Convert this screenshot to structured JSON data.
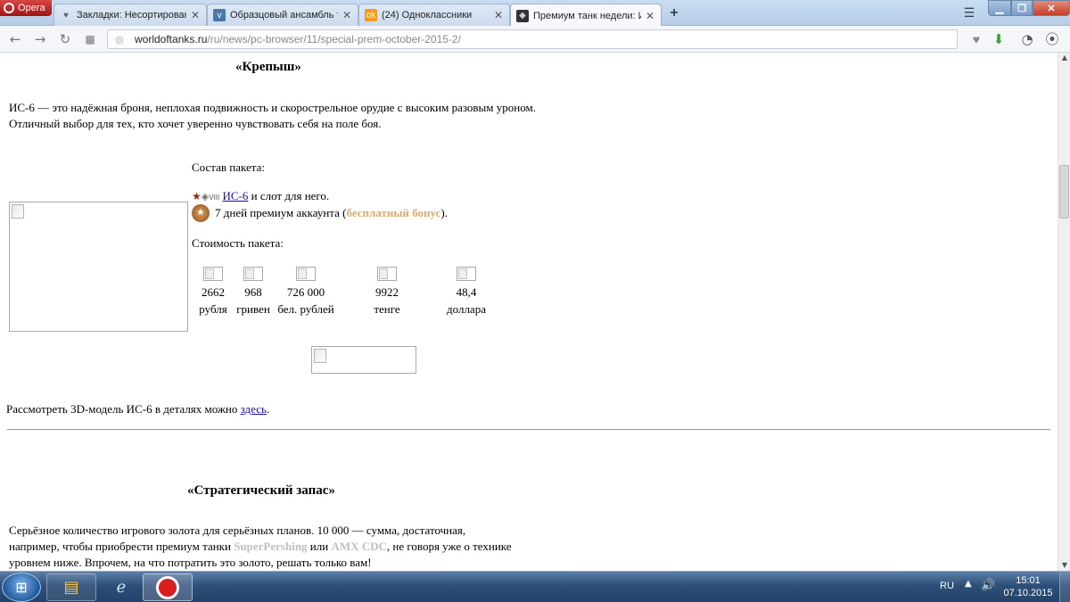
{
  "browser": {
    "menu_label": "Opera",
    "tabs": [
      {
        "label": "Закладки: Несортирован",
        "icon": "heart-icon"
      },
      {
        "label": "Образцовый ансамбль т",
        "icon": "vk-icon"
      },
      {
        "label": "(24) Одноклассники",
        "icon": "ok-icon"
      },
      {
        "label": "Премиум танк недели: И",
        "icon": "wot-icon"
      }
    ],
    "new_tab_symbol": "+",
    "address": {
      "host": "worldoftanks.ru",
      "path": "/ru/news/pc-browser/11/special-prem-october-2015-2/"
    }
  },
  "page": {
    "section1": {
      "title": "«Крепыш»",
      "description": "ИС-6 — это надёжная броня, неплохая подвижность и скорострельное орудие с высоким разовым уроном. Отличный выбор для тех, кто хочет уверенно чувствовать себя на поле боя.",
      "package_heading": "Состав пакета:",
      "tank_level": "VIII",
      "tank_link": "ИС-6",
      "tank_suffix": " и слот для него.",
      "premium_text": "7 дней премиум аккаунта (",
      "premium_bonus": "бесплатный бонус",
      "premium_close": ").",
      "price_heading": "Стоимость пакета:",
      "prices": [
        {
          "value": "2662",
          "currency": "рубля"
        },
        {
          "value": "968",
          "currency": "гривен"
        },
        {
          "value": "726 000",
          "currency": "бел. рублей"
        },
        {
          "value": "9922",
          "currency": "тенге"
        },
        {
          "value": "48,4",
          "currency": "доллара"
        }
      ],
      "model_text": "Рассмотреть 3D-модель ИС-6 в деталях можно ",
      "model_link": "здесь",
      "model_end": "."
    },
    "section2": {
      "title": "«Стратегический запас»",
      "text1": "Серьёзное количество игрового золота для серьёзных планов. 10 000 — сумма, достаточная, например, чтобы приобрести премиум танки ",
      "tank_a": "SuperPershing",
      "text2": " или ",
      "tank_b": "AMX CDC",
      "text3": ", не говоря уже о технике уровнем ниже. Впрочем, на что потратить это золото, решать только вам!"
    }
  },
  "taskbar": {
    "language": "RU",
    "time": "15:01",
    "date": "07.10.2015"
  },
  "colors": {
    "link": "#1a0dab",
    "bonus": "#e0a96e",
    "muted_tank": "#bfbfbf"
  }
}
